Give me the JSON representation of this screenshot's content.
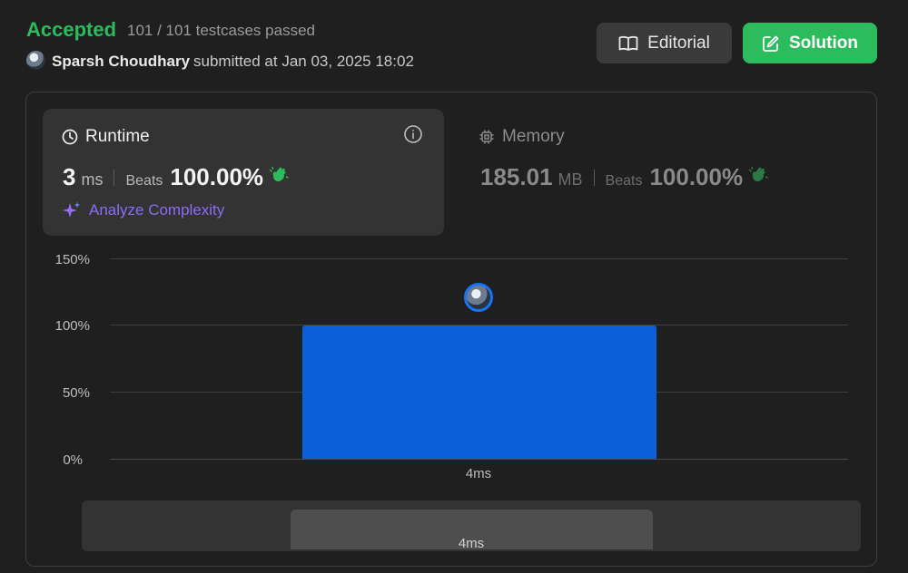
{
  "header": {
    "status": "Accepted",
    "testcases": "101 / 101 testcases passed",
    "author": "Sparsh Choudhary",
    "submitted": "submitted at Jan 03, 2025 18:02"
  },
  "buttons": {
    "editorial": "Editorial",
    "solution": "Solution"
  },
  "runtime": {
    "title": "Runtime",
    "value": "3",
    "unit": "ms",
    "beats_label": "Beats",
    "beats_value": "100.00%",
    "analyze": "Analyze Complexity"
  },
  "memory": {
    "title": "Memory",
    "value": "185.01",
    "unit": "MB",
    "beats_label": "Beats",
    "beats_value": "100.00%"
  },
  "chart_data": {
    "type": "bar",
    "categories": [
      "4ms"
    ],
    "values": [
      100
    ],
    "ylim": [
      0,
      150
    ],
    "yticks": [
      "150%",
      "100%",
      "50%",
      "0%"
    ],
    "grid": true
  },
  "range": {
    "label": "4ms"
  },
  "colors": {
    "accepted": "#2cbb5d",
    "bar": "#0a5fdb",
    "analyze": "#8b6cf6"
  }
}
